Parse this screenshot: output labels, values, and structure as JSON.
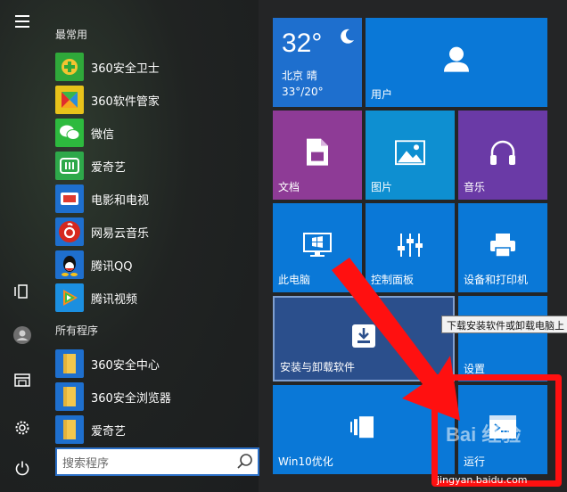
{
  "rail": {
    "menu_icon": "hamburger-icon",
    "items": [
      "tablet-mode-icon",
      "user-icon",
      "file-explorer-icon",
      "settings-gear-icon",
      "power-icon"
    ]
  },
  "applist": {
    "frequent_header": "最常用",
    "frequent": [
      {
        "label": "360安全卫士",
        "icon": "360-safeguard-icon",
        "color": "#2fa83a"
      },
      {
        "label": "360软件管家",
        "icon": "360-software-manager-icon",
        "color": "#e8c21a"
      },
      {
        "label": "微信",
        "icon": "wechat-icon",
        "color": "#ffffff"
      },
      {
        "label": "爱奇艺",
        "icon": "iqiyi-icon",
        "color": "#2ea84a"
      },
      {
        "label": "电影和电视",
        "icon": "movies-tv-icon",
        "color": "#1e6fce"
      },
      {
        "label": "网易云音乐",
        "icon": "netease-music-icon",
        "color": "#d6281f"
      },
      {
        "label": "腾讯QQ",
        "icon": "qq-icon",
        "color": "#ffffff"
      },
      {
        "label": "腾讯视频",
        "icon": "tencent-video-icon",
        "color": "#1b8fe0"
      }
    ],
    "all_header": "所有程序",
    "all": [
      {
        "label": "360安全中心",
        "icon": "folder-icon",
        "color": "#f3c74d"
      },
      {
        "label": "360安全浏览器",
        "icon": "folder-icon",
        "color": "#f3c74d"
      },
      {
        "label": "爱奇艺",
        "icon": "folder-icon",
        "color": "#f3c74d"
      }
    ],
    "search_placeholder": "搜索程序"
  },
  "tiles": {
    "weather": {
      "temp": "32°",
      "city": "北京  晴",
      "range": "33°/20°",
      "color": "#1e6fce"
    },
    "user": {
      "label": "用户",
      "color": "#0a78d7"
    },
    "documents": {
      "label": "文档",
      "color": "#8e3b96"
    },
    "pictures": {
      "label": "图片",
      "color": "#0e8fd1"
    },
    "music": {
      "label": "音乐",
      "color": "#6a3aa6"
    },
    "this_pc": {
      "label": "此电脑",
      "color": "#0a78d7"
    },
    "control_panel": {
      "label": "控制面板",
      "color": "#0a78d7"
    },
    "devices_printers": {
      "label": "设备和打印机",
      "color": "#0a78d7"
    },
    "uninstall": {
      "label": "安装与卸载软件",
      "color": "#2b4f8c"
    },
    "settings": {
      "label": "设置",
      "color": "#0a78d7"
    },
    "win10": {
      "label": "Win10优化",
      "color": "#0a78d7"
    },
    "run": {
      "label": "运行",
      "color": "#0a78d7"
    }
  },
  "tooltip": "下载安装软件或卸载电脑上",
  "watermark": {
    "brand": "Bai 经验",
    "url": "jingyan.baidu.com"
  },
  "colors": {
    "annotation_red": "#ff1010",
    "accent_blue": "#0a78d7"
  }
}
